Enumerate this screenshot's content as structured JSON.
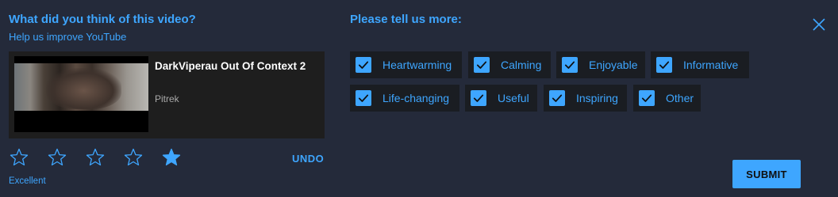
{
  "header": {
    "question": "What did you think of this video?",
    "subtitle": "Help us improve YouTube",
    "more_prompt": "Please tell us more:"
  },
  "video": {
    "title": "DarkViperau Out Of Context 2",
    "channel": "Pitrek"
  },
  "rating": {
    "selected": 5,
    "max": 5,
    "label": "Excellent",
    "undo_label": "UNDO"
  },
  "options": [
    {
      "label": "Heartwarming",
      "checked": true
    },
    {
      "label": "Calming",
      "checked": true
    },
    {
      "label": "Enjoyable",
      "checked": true
    },
    {
      "label": "Informative",
      "checked": true
    },
    {
      "label": "Life-changing",
      "checked": true
    },
    {
      "label": "Useful",
      "checked": true
    },
    {
      "label": "Inspiring",
      "checked": true
    },
    {
      "label": "Other",
      "checked": true
    }
  ],
  "submit_label": "SUBMIT",
  "colors": {
    "accent": "#3ea6ff",
    "background": "#242a3a",
    "chip": "#1a1d22"
  }
}
